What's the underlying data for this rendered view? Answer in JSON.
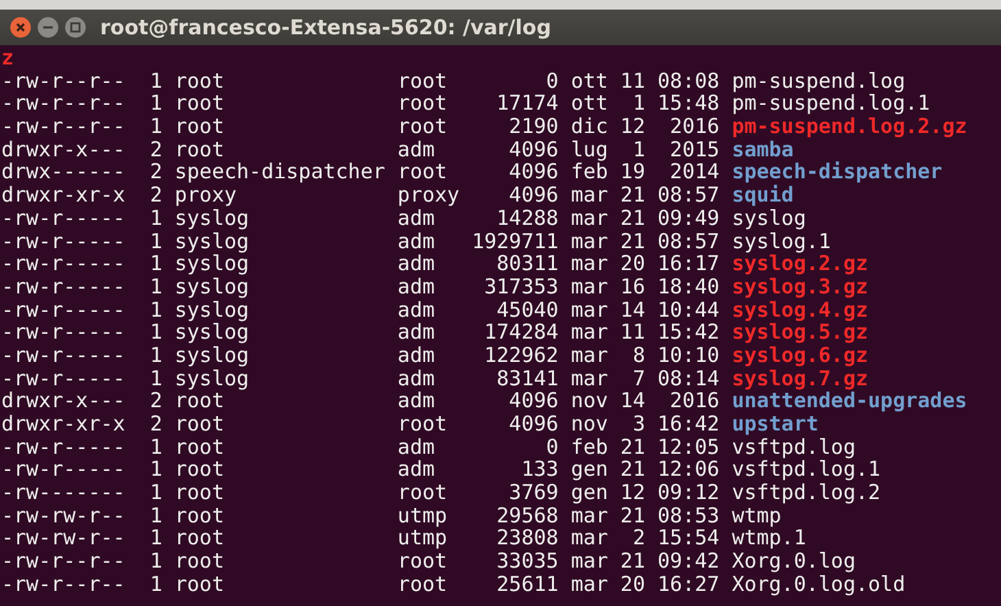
{
  "window": {
    "title": "root@francesco-Extensa-5620: /var/log"
  },
  "terminal": {
    "prompt_fragment": "z",
    "rows": [
      {
        "permissions": "-rw-r--r--",
        "links": "1",
        "owner": "root",
        "group": "root",
        "size": "0",
        "date": "ott 11 08:08",
        "name": "pm-suspend.log",
        "kind": "file"
      },
      {
        "permissions": "-rw-r--r--",
        "links": "1",
        "owner": "root",
        "group": "root",
        "size": "17174",
        "date": "ott  1 15:48",
        "name": "pm-suspend.log.1",
        "kind": "file"
      },
      {
        "permissions": "-rw-r--r--",
        "links": "1",
        "owner": "root",
        "group": "root",
        "size": "2190",
        "date": "dic 12  2016",
        "name": "pm-suspend.log.2.gz",
        "kind": "archive"
      },
      {
        "permissions": "drwxr-x---",
        "links": "2",
        "owner": "root",
        "group": "adm",
        "size": "4096",
        "date": "lug  1  2015",
        "name": "samba",
        "kind": "directory"
      },
      {
        "permissions": "drwx------",
        "links": "2",
        "owner": "speech-dispatcher",
        "group": "root",
        "size": "4096",
        "date": "feb 19  2014",
        "name": "speech-dispatcher",
        "kind": "directory"
      },
      {
        "permissions": "drwxr-xr-x",
        "links": "2",
        "owner": "proxy",
        "group": "proxy",
        "size": "4096",
        "date": "mar 21 08:57",
        "name": "squid",
        "kind": "directory"
      },
      {
        "permissions": "-rw-r-----",
        "links": "1",
        "owner": "syslog",
        "group": "adm",
        "size": "14288",
        "date": "mar 21 09:49",
        "name": "syslog",
        "kind": "file"
      },
      {
        "permissions": "-rw-r-----",
        "links": "1",
        "owner": "syslog",
        "group": "adm",
        "size": "1929711",
        "date": "mar 21 08:57",
        "name": "syslog.1",
        "kind": "file"
      },
      {
        "permissions": "-rw-r-----",
        "links": "1",
        "owner": "syslog",
        "group": "adm",
        "size": "80311",
        "date": "mar 20 16:17",
        "name": "syslog.2.gz",
        "kind": "archive"
      },
      {
        "permissions": "-rw-r-----",
        "links": "1",
        "owner": "syslog",
        "group": "adm",
        "size": "317353",
        "date": "mar 16 18:40",
        "name": "syslog.3.gz",
        "kind": "archive"
      },
      {
        "permissions": "-rw-r-----",
        "links": "1",
        "owner": "syslog",
        "group": "adm",
        "size": "45040",
        "date": "mar 14 10:44",
        "name": "syslog.4.gz",
        "kind": "archive"
      },
      {
        "permissions": "-rw-r-----",
        "links": "1",
        "owner": "syslog",
        "group": "adm",
        "size": "174284",
        "date": "mar 11 15:42",
        "name": "syslog.5.gz",
        "kind": "archive"
      },
      {
        "permissions": "-rw-r-----",
        "links": "1",
        "owner": "syslog",
        "group": "adm",
        "size": "122962",
        "date": "mar  8 10:10",
        "name": "syslog.6.gz",
        "kind": "archive"
      },
      {
        "permissions": "-rw-r-----",
        "links": "1",
        "owner": "syslog",
        "group": "adm",
        "size": "83141",
        "date": "mar  7 08:14",
        "name": "syslog.7.gz",
        "kind": "archive"
      },
      {
        "permissions": "drwxr-x---",
        "links": "2",
        "owner": "root",
        "group": "adm",
        "size": "4096",
        "date": "nov 14  2016",
        "name": "unattended-upgrades",
        "kind": "directory"
      },
      {
        "permissions": "drwxr-xr-x",
        "links": "2",
        "owner": "root",
        "group": "root",
        "size": "4096",
        "date": "nov  3 16:42",
        "name": "upstart",
        "kind": "directory"
      },
      {
        "permissions": "-rw-r-----",
        "links": "1",
        "owner": "root",
        "group": "adm",
        "size": "0",
        "date": "feb 21 12:05",
        "name": "vsftpd.log",
        "kind": "file"
      },
      {
        "permissions": "-rw-r-----",
        "links": "1",
        "owner": "root",
        "group": "adm",
        "size": "133",
        "date": "gen 21 12:06",
        "name": "vsftpd.log.1",
        "kind": "file"
      },
      {
        "permissions": "-rw-------",
        "links": "1",
        "owner": "root",
        "group": "root",
        "size": "3769",
        "date": "gen 12 09:12",
        "name": "vsftpd.log.2",
        "kind": "file"
      },
      {
        "permissions": "-rw-rw-r--",
        "links": "1",
        "owner": "root",
        "group": "utmp",
        "size": "29568",
        "date": "mar 21 08:53",
        "name": "wtmp",
        "kind": "file"
      },
      {
        "permissions": "-rw-rw-r--",
        "links": "1",
        "owner": "root",
        "group": "utmp",
        "size": "23808",
        "date": "mar  2 15:54",
        "name": "wtmp.1",
        "kind": "file"
      },
      {
        "permissions": "-rw-r--r--",
        "links": "1",
        "owner": "root",
        "group": "root",
        "size": "33035",
        "date": "mar 21 09:42",
        "name": "Xorg.0.log",
        "kind": "file"
      },
      {
        "permissions": "-rw-r--r--",
        "links": "1",
        "owner": "root",
        "group": "root",
        "size": "25611",
        "date": "mar 20 16:27",
        "name": "Xorg.0.log.old",
        "kind": "file"
      }
    ]
  }
}
